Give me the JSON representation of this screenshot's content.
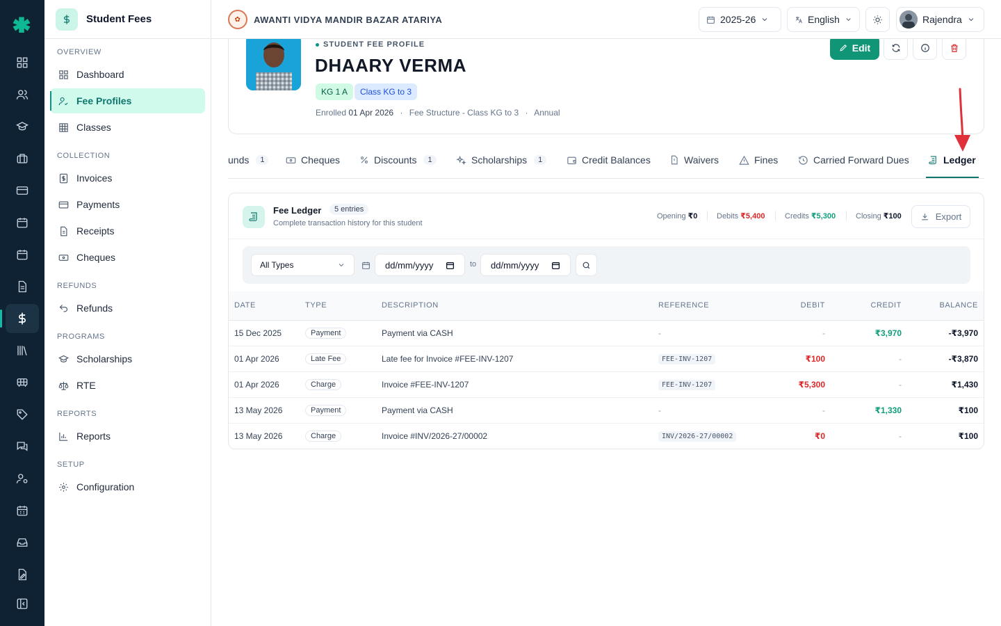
{
  "app": {
    "title": "Student Fees",
    "rail_icons": [
      "dashboard-grid-icon",
      "users-icon",
      "graduation-cap-icon",
      "briefcase-icon",
      "card-icon",
      "calendar-icon",
      "calendar-check-icon",
      "document-icon",
      "dollar-icon",
      "library-icon",
      "bus-icon",
      "tag-icon",
      "messages-icon",
      "user-cog-icon",
      "calendar-grid-icon",
      "inbox-icon",
      "file-edit-icon",
      "collapse-panel-icon"
    ]
  },
  "sidebar": {
    "sections": [
      {
        "label": "OVERVIEW",
        "items": [
          {
            "label": "Dashboard",
            "icon": "grid-icon"
          },
          {
            "label": "Fee Profiles",
            "icon": "user-check-icon",
            "active": true
          },
          {
            "label": "Classes",
            "icon": "table-icon"
          }
        ]
      },
      {
        "label": "COLLECTION",
        "items": [
          {
            "label": "Invoices",
            "icon": "dollar-doc-icon"
          },
          {
            "label": "Payments",
            "icon": "credit-card-icon"
          },
          {
            "label": "Receipts",
            "icon": "receipt-icon"
          },
          {
            "label": "Cheques",
            "icon": "banknote-icon"
          }
        ]
      },
      {
        "label": "REFUNDS",
        "items": [
          {
            "label": "Refunds",
            "icon": "undo-icon"
          }
        ]
      },
      {
        "label": "PROGRAMS",
        "items": [
          {
            "label": "Scholarships",
            "icon": "graduation-cap-icon"
          },
          {
            "label": "RTE",
            "icon": "scale-icon"
          }
        ]
      },
      {
        "label": "REPORTS",
        "items": [
          {
            "label": "Reports",
            "icon": "bar-chart-icon"
          }
        ]
      },
      {
        "label": "SETUP",
        "items": [
          {
            "label": "Configuration",
            "icon": "gear-icon"
          }
        ]
      }
    ]
  },
  "topbar": {
    "school_name": "AWANTI VIDYA MANDIR BAZAR ATARIYA",
    "year": "2025-26",
    "language": "English",
    "user": "Rajendra"
  },
  "profile": {
    "kicker": "STUDENT FEE PROFILE",
    "name": "DHAARY VERMA",
    "chips": [
      "KG 1 A",
      "Class KG to 3"
    ],
    "enrolled_label": "Enrolled",
    "enrolled_date": "01 Apr 2026",
    "structure": "Fee Structure - Class KG to 3",
    "frequency": "Annual",
    "edit_label": "Edit"
  },
  "tabs": [
    {
      "label": "unds",
      "count": "1"
    },
    {
      "label": "Cheques"
    },
    {
      "label": "Discounts",
      "count": "1"
    },
    {
      "label": "Scholarships",
      "count": "1"
    },
    {
      "label": "Credit Balances"
    },
    {
      "label": "Waivers"
    },
    {
      "label": "Fines"
    },
    {
      "label": "Carried Forward Dues"
    },
    {
      "label": "Ledger",
      "active": true
    }
  ],
  "ledger": {
    "title": "Fee Ledger",
    "entries_badge": "5 entries",
    "subtitle": "Complete transaction history for this student",
    "opening_label": "Opening",
    "opening": "₹0",
    "debits_label": "Debits",
    "debits": "₹5,400",
    "credits_label": "Credits",
    "credits": "₹5,300",
    "closing_label": "Closing",
    "closing": "₹100",
    "export_label": "Export",
    "filter_type": "All Types",
    "date_from_placeholder": "dd/mm/yyyy",
    "date_to_placeholder": "dd/mm/yyyy",
    "to_label": "to",
    "columns": [
      "DATE",
      "TYPE",
      "DESCRIPTION",
      "REFERENCE",
      "DEBIT",
      "CREDIT",
      "BALANCE"
    ],
    "rows": [
      {
        "date": "15 Dec 2025",
        "type": "Payment",
        "description": "Payment via CASH",
        "reference": "-",
        "debit": "-",
        "credit": "₹3,970",
        "balance": "-₹3,970"
      },
      {
        "date": "01 Apr 2026",
        "type": "Late Fee",
        "description": "Late fee for Invoice #FEE-INV-1207",
        "reference": "FEE-INV-1207",
        "debit": "₹100",
        "credit": "-",
        "balance": "-₹3,870"
      },
      {
        "date": "01 Apr 2026",
        "type": "Charge",
        "description": "Invoice #FEE-INV-1207",
        "reference": "FEE-INV-1207",
        "debit": "₹5,300",
        "credit": "-",
        "balance": "₹1,430"
      },
      {
        "date": "13 May 2026",
        "type": "Payment",
        "description": "Payment via CASH",
        "reference": "-",
        "debit": "-",
        "credit": "₹1,330",
        "balance": "₹100"
      },
      {
        "date": "13 May 2026",
        "type": "Charge",
        "description": "Invoice #INV/2026-27/00002",
        "reference": "INV/2026-27/00002",
        "debit": "₹0",
        "credit": "-",
        "balance": "₹100"
      }
    ]
  },
  "colors": {
    "accent": "#119577",
    "rail": "#0f2233",
    "debit": "#dc2626",
    "credit": "#0f9d7a",
    "annotation_arrow": "#e0303a"
  }
}
